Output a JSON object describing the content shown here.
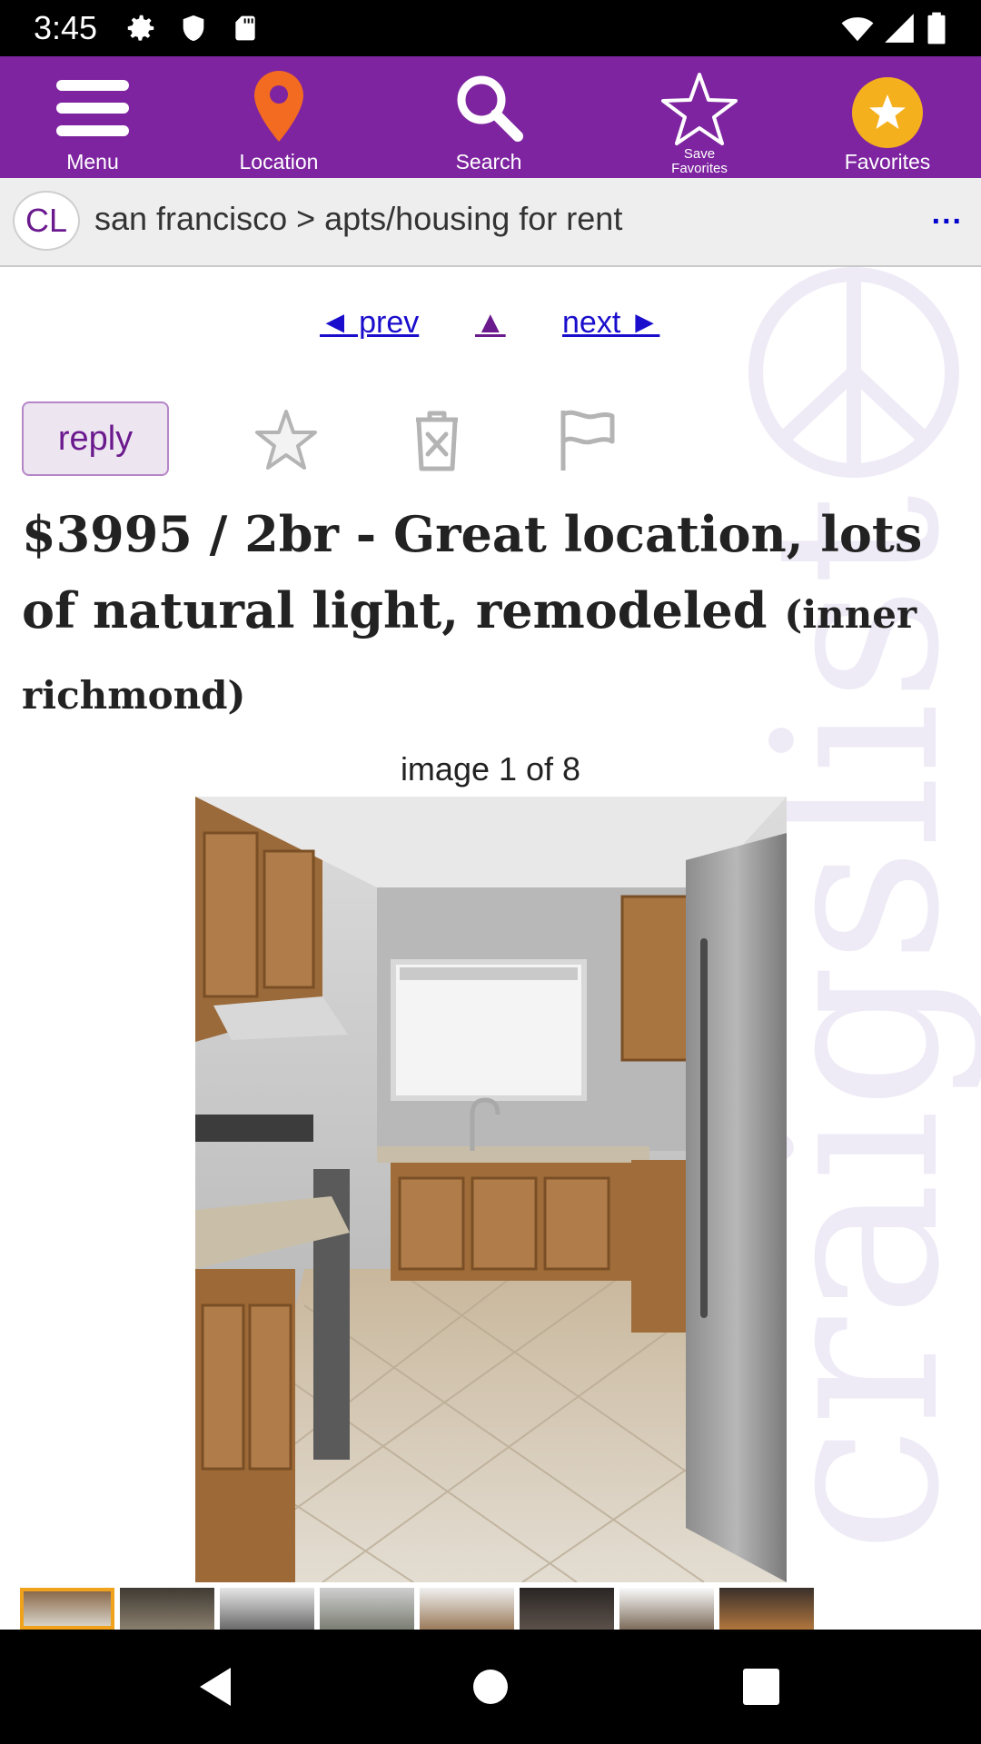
{
  "status_bar": {
    "time": "3:45",
    "left_icons": [
      "gear-icon",
      "shield-icon",
      "sd-card-icon"
    ],
    "right_icons": [
      "wifi-icon",
      "signal-icon",
      "battery-icon"
    ]
  },
  "toolbar": {
    "items": [
      {
        "label": "Menu",
        "icon": "hamburger-menu-icon"
      },
      {
        "label": "Location",
        "icon": "location-pin-icon"
      },
      {
        "label": "Search",
        "icon": "magnifier-icon"
      },
      {
        "label": "Save Favorites",
        "icon": "star-outline-icon"
      },
      {
        "label": "Favorites",
        "icon": "star-filled-icon"
      }
    ],
    "colors": {
      "background": "#7e24a0",
      "pin": "#f26b21",
      "favorites_badge": "#f5b01e"
    }
  },
  "breadcrumb": {
    "logo": "CL",
    "path": "san francisco > apts/housing for rent",
    "more": "..."
  },
  "navigation_links": {
    "prev": "◄ prev",
    "up": "▲",
    "next": "next ►"
  },
  "actions": {
    "reply": "reply",
    "icons": [
      "favorite-star-icon",
      "hide-trash-icon",
      "flag-icon"
    ]
  },
  "post": {
    "title_main": "$3995 / 2br - Great location, lots of natural light, remodeled",
    "neighborhood": "(inner richmond)"
  },
  "gallery": {
    "counter": "image 1 of 8",
    "current_index": 1,
    "total": 8
  },
  "watermark": "craigslist",
  "system_nav": [
    "back-icon",
    "home-icon",
    "recents-icon"
  ]
}
